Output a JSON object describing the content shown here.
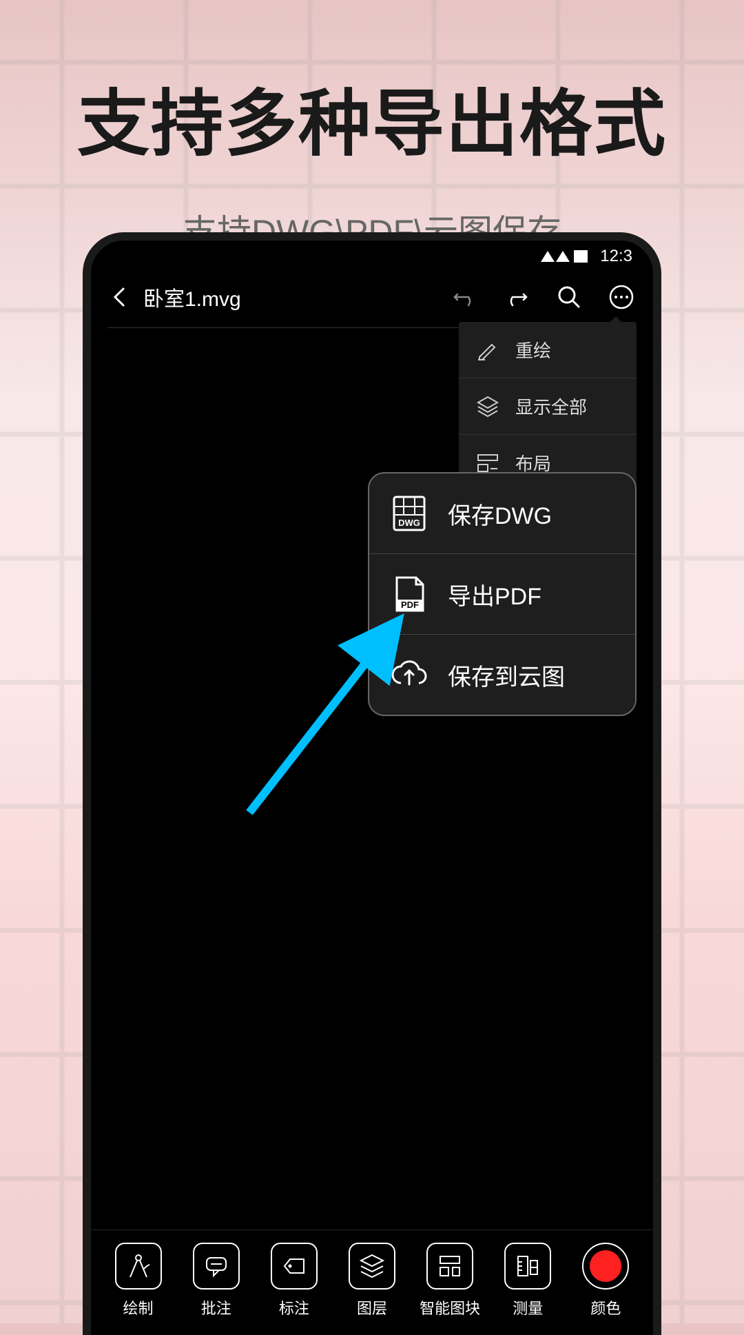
{
  "title": {
    "main": "支持多种导出格式",
    "sub": "支持DWG\\PDF\\云图保存"
  },
  "statusBar": {
    "time": "12:3"
  },
  "header": {
    "fileName": "卧室1.mvg"
  },
  "dropdown": {
    "items": [
      {
        "label": "重绘"
      },
      {
        "label": "显示全部"
      },
      {
        "label": "布局"
      }
    ]
  },
  "exportMenu": {
    "items": [
      {
        "label": "保存DWG",
        "iconText": "DWG"
      },
      {
        "label": "导出PDF",
        "iconText": "PDF"
      },
      {
        "label": "保存到云图"
      }
    ]
  },
  "bottomToolbar": {
    "items": [
      {
        "label": "绘制"
      },
      {
        "label": "批注"
      },
      {
        "label": "标注"
      },
      {
        "label": "图层"
      },
      {
        "label": "智能图块"
      },
      {
        "label": "测量"
      },
      {
        "label": "颜色"
      }
    ]
  }
}
